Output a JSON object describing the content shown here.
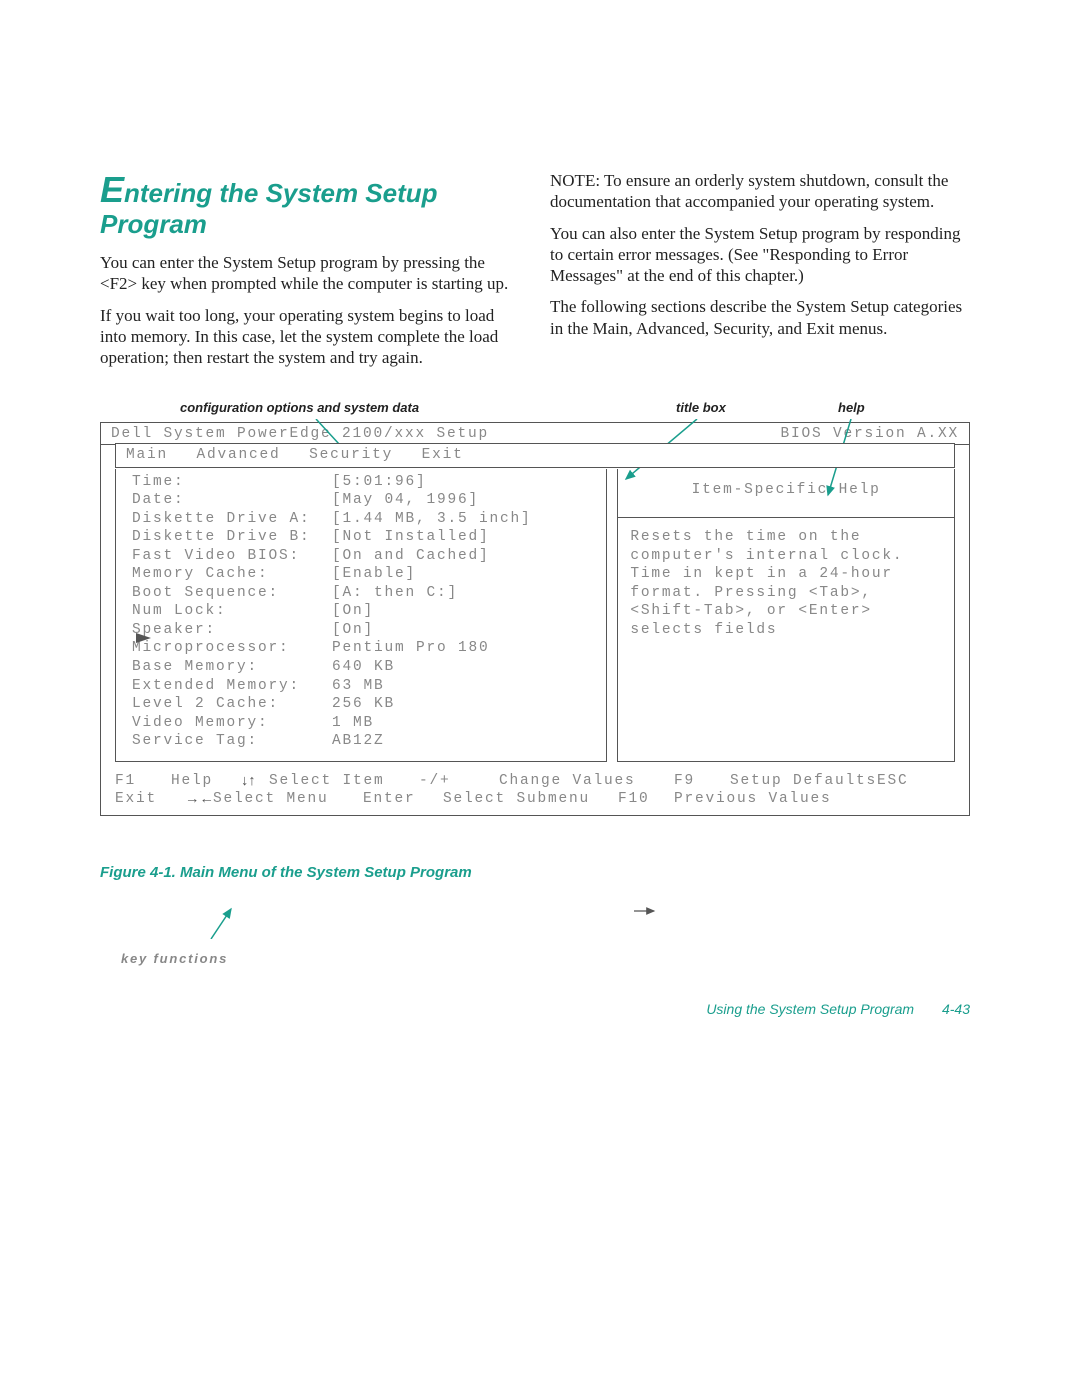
{
  "heading_cap": "E",
  "heading_rest": "ntering the System Setup Program",
  "left_paras": [
    "You can enter the System Setup program by pressing the <F2> key when prompted while the computer is starting up.",
    "If you wait too long, your operating system begins to load into memory. In this case, let the system complete the load operation; then restart the system and try again."
  ],
  "right_paras": [
    "NOTE: To ensure an orderly system shutdown, consult the documentation that accompanied your operating system.",
    "You can also enter the System Setup program by responding to certain error messages. (See \"Responding to Error Messages\" at the end of this chapter.)",
    "The following sections describe the System Setup categories in the Main, Advanced, Security, and Exit menus."
  ],
  "annot": {
    "config": "configuration options and system data",
    "title": "title box",
    "help": "help",
    "keyfn": "key functions"
  },
  "bios": {
    "title_left": "Dell System PowerEdge 2100/xxx Setup",
    "title_right": "BIOS Version A.XX",
    "menus": [
      "Main",
      "Advanced",
      "Security",
      "Exit"
    ],
    "fields": [
      {
        "label": "Time:",
        "value": "[5:01:96]"
      },
      {
        "label": "Date:",
        "value": "[May 04, 1996]"
      },
      {
        "label": "Diskette Drive A:",
        "value": "[1.44 MB, 3.5 inch]"
      },
      {
        "label": "Diskette Drive B:",
        "value": "[Not Installed]"
      },
      {
        "label": "Fast Video BIOS:",
        "value": "[On and Cached]"
      },
      {
        "label": "Memory Cache:",
        "value": "[Enable]"
      },
      {
        "label": "Boot Sequence:",
        "value": "[A: then C:]"
      },
      {
        "label": "Num Lock:",
        "value": "[On]"
      },
      {
        "label": "Speaker:",
        "value": "[On]"
      },
      {
        "label": "Microprocessor:",
        "value": "Pentium Pro 180"
      },
      {
        "label": "Base Memory:",
        "value": "640 KB"
      },
      {
        "label": "Extended Memory:",
        "value": "63 MB"
      },
      {
        "label": "Level 2 Cache:",
        "value": "256 KB"
      },
      {
        "label": "Video Memory:",
        "value": "1 MB"
      },
      {
        "label": "Service Tag:",
        "value": "AB12Z"
      }
    ],
    "help_title": "Item-Specific Help",
    "help_body": "Resets the time on the computer's internal clock. Time in kept in a 24-hour format. Pressing <Tab>, <Shift-Tab>, or <Enter> selects fields",
    "keys": {
      "f1": "F1",
      "help": "Help",
      "esc": "ESC",
      "exit": "Exit",
      "selitem": "Select Item",
      "selmenu": "Select Menu",
      "pm": "-/+",
      "chg": "Change Values",
      "enter": "Enter",
      "selsub": "Select Submenu",
      "f9": "F9",
      "setdef": "Setup Defaults",
      "f10": "F10",
      "prev": "Previous Values"
    }
  },
  "figcap": "Figure 4-1.  Main Menu of the System Setup Program",
  "footer_text": "Using the System Setup Program",
  "footer_page": "4-43"
}
